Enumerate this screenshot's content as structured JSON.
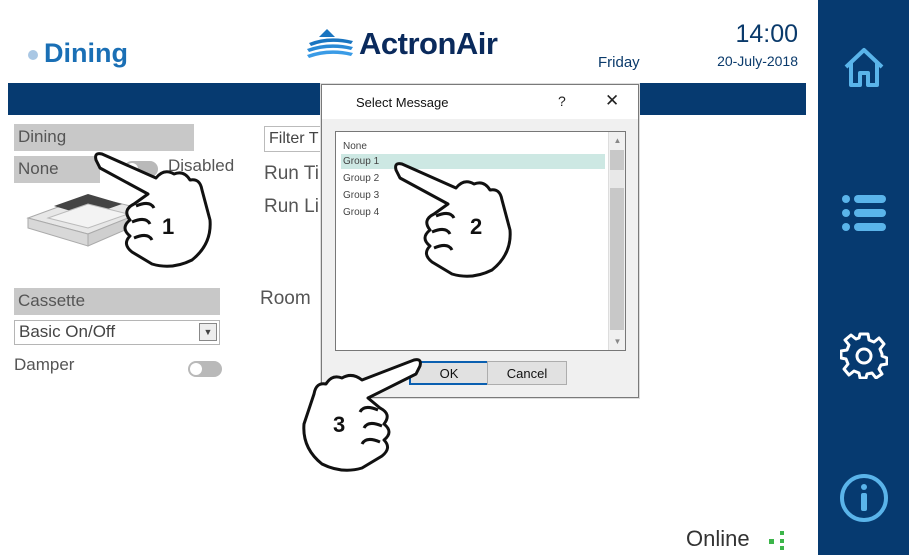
{
  "header": {
    "zone_title": "Dining",
    "brand": "ActronAir",
    "day": "Friday",
    "time": "14:00",
    "date": "20-July-2018"
  },
  "left_panel": {
    "zone_name": "Dining",
    "group_value": "None",
    "enable_state": "Disabled",
    "unit_type": "Cassette",
    "control_mode": "Basic On/Off",
    "damper_label": "Damper"
  },
  "middle_panel": {
    "filter_label": "Filter T",
    "run_time_label": "Run Ti",
    "run_limit_label": "Run Li",
    "room_label": "Room"
  },
  "status": {
    "online_label": "Online"
  },
  "dialog": {
    "title": "Select Message",
    "help": "?",
    "close": "✕",
    "options": [
      "None",
      "Group 1",
      "Group 2",
      "Group 3",
      "Group 4"
    ],
    "selected": "Group 1",
    "ok_label": "OK",
    "cancel_label": "Cancel"
  },
  "callouts": [
    "1",
    "2",
    "3"
  ],
  "sidenav": {
    "items": [
      "home-icon",
      "menu-icon",
      "settings-icon",
      "info-icon"
    ]
  },
  "colors": {
    "nav_blue": "#063a70",
    "title_blue": "#1a6fb5",
    "highlight": "#cde8e3",
    "online_green": "#3cb54a"
  }
}
